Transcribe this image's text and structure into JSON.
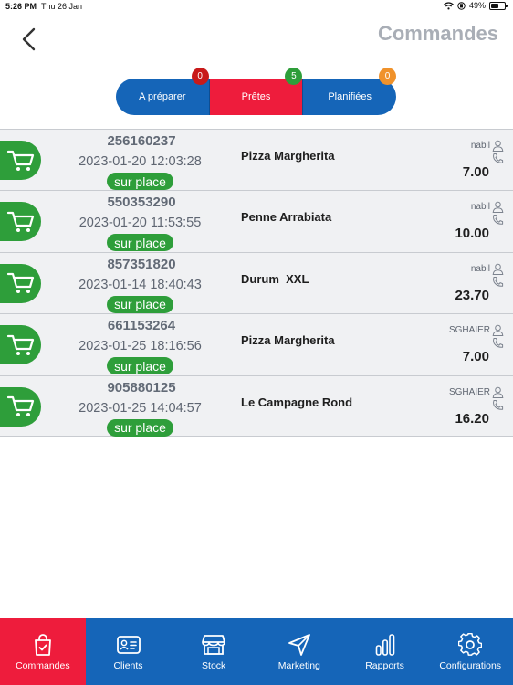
{
  "status_bar": {
    "time": "5:26 PM",
    "date": "Thu 26 Jan",
    "battery": "49%"
  },
  "header": {
    "title": "Commandes"
  },
  "tabs": [
    {
      "label": "A préparer",
      "badge": "0",
      "badge_color": "#c81a1a"
    },
    {
      "label": "Prêtes",
      "badge": "5",
      "badge_color": "#2e9e3a"
    },
    {
      "label": "Planifiées",
      "badge": "0",
      "badge_color": "#f0922b"
    }
  ],
  "orders": [
    {
      "number": "256160237",
      "datetime": "2023-01-20 12:03:28",
      "type": "sur place",
      "product": "Pizza Margherita",
      "user": "nabil",
      "price": "7.00"
    },
    {
      "number": "550353290",
      "datetime": "2023-01-20 11:53:55",
      "type": "sur place",
      "product": "Penne Arrabiata",
      "user": "nabil",
      "price": "10.00"
    },
    {
      "number": "857351820",
      "datetime": "2023-01-14 18:40:43",
      "type": "sur place",
      "product": "Durum  XXL",
      "user": "nabil",
      "price": "23.70"
    },
    {
      "number": "661153264",
      "datetime": "2023-01-25 18:16:56",
      "type": "sur place",
      "product": "Pizza Margherita",
      "user": "SGHAIER",
      "price": "7.00"
    },
    {
      "number": "905880125",
      "datetime": "2023-01-25 14:04:57",
      "type": "sur place",
      "product": "Le Campagne Rond",
      "user": "SGHAIER",
      "price": "16.20"
    }
  ],
  "nav": [
    {
      "label": "Commandes",
      "icon": "bag-check-icon"
    },
    {
      "label": "Clients",
      "icon": "id-card-icon"
    },
    {
      "label": "Stock",
      "icon": "store-icon"
    },
    {
      "label": "Marketing",
      "icon": "navigation-arrow-icon"
    },
    {
      "label": "Rapports",
      "icon": "bar-chart-icon"
    },
    {
      "label": "Configurations",
      "icon": "gear-icon"
    }
  ],
  "colors": {
    "primary_blue": "#1565b8",
    "accent_red": "#ee1c3c",
    "green": "#2e9e3a",
    "title_gray": "#a9aeb6"
  }
}
